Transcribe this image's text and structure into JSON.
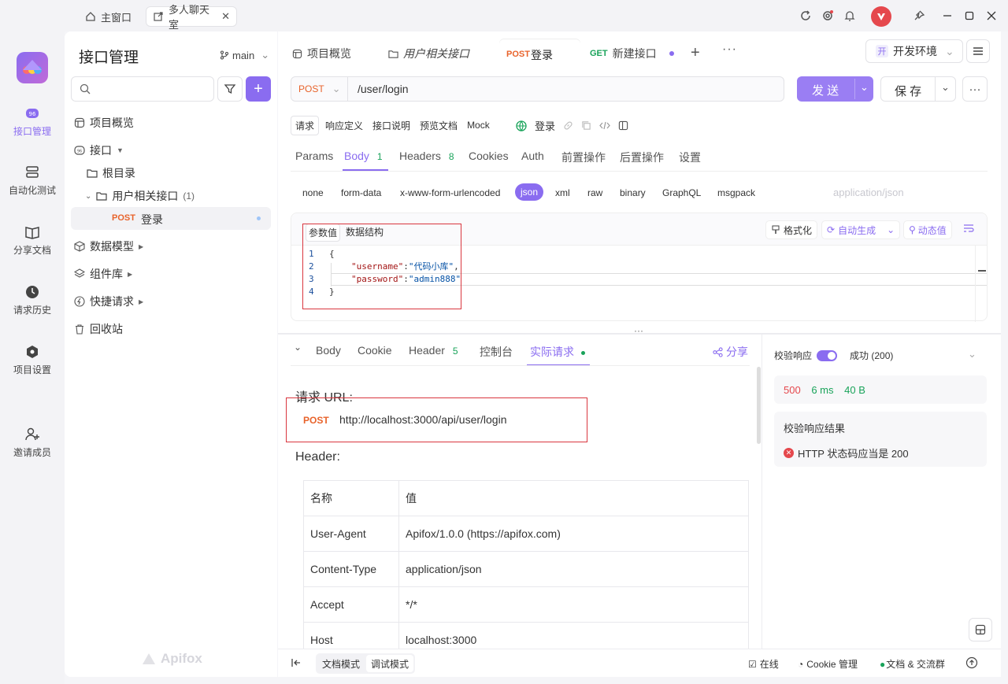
{
  "window": {
    "tabs": [
      {
        "label": "主窗口"
      },
      {
        "label": "多人聊天室"
      }
    ]
  },
  "leftbar": {
    "items": [
      {
        "label": "接口管理"
      },
      {
        "label": "自动化测试"
      },
      {
        "label": "分享文档"
      },
      {
        "label": "请求历史"
      },
      {
        "label": "项目设置"
      },
      {
        "label": "邀请成员"
      }
    ],
    "logo_text": "Apifox"
  },
  "sidepanel": {
    "title": "接口管理",
    "branch": "main",
    "tree": {
      "overview": "项目概览",
      "interfaces": "接口",
      "root": "根目录",
      "folder": "用户相关接口",
      "folder_count": "(1)",
      "endpoint_method": "POST",
      "endpoint_name": "登录",
      "data_models": "数据模型",
      "components": "组件库",
      "quick_request": "快捷请求",
      "recycle": "回收站"
    }
  },
  "main": {
    "tabs": [
      {
        "label": "项目概览"
      },
      {
        "label": "用户相关接口"
      },
      {
        "method": "POST",
        "label": "登录"
      },
      {
        "method": "GET",
        "label": "新建接口"
      }
    ],
    "env": {
      "badge": "开",
      "label": "开发环境"
    },
    "request": {
      "method": "POST",
      "url": "/user/login",
      "send": "发 送",
      "save": "保 存"
    },
    "mode_tabs": [
      "请求",
      "响应定义",
      "接口说明",
      "预览文档",
      "Mock"
    ],
    "endpoint_label": "登录",
    "param_tabs": [
      {
        "label": "Params"
      },
      {
        "label": "Body",
        "count": "1"
      },
      {
        "label": "Headers",
        "count": "8"
      },
      {
        "label": "Cookies"
      },
      {
        "label": "Auth"
      },
      {
        "label": "前置操作"
      },
      {
        "label": "后置操作"
      },
      {
        "label": "设置"
      }
    ],
    "body_types": [
      "none",
      "form-data",
      "x-www-form-urlencoded",
      "json",
      "xml",
      "raw",
      "binary",
      "GraphQL",
      "msgpack"
    ],
    "content_type": "application/json",
    "editor": {
      "tabs": [
        "参数值",
        "数据结构"
      ],
      "tools": {
        "format": "格式化",
        "auto": "自动生成",
        "dynamic": "动态值"
      },
      "lines": [
        {
          "n": "1",
          "text": "{"
        },
        {
          "n": "2",
          "key": "\"username\"",
          "value": "\"代码小库\"",
          "sep": ":",
          "end": ","
        },
        {
          "n": "3",
          "key": "\"password\"",
          "value": "\"admin888\"",
          "sep": ":",
          "end": ""
        },
        {
          "n": "4",
          "text": "}"
        }
      ]
    },
    "response": {
      "tabs": [
        {
          "label": "Body"
        },
        {
          "label": "Cookie"
        },
        {
          "label": "Header",
          "count": "5"
        },
        {
          "label": "控制台"
        },
        {
          "label": "实际请求"
        }
      ],
      "share": "分享",
      "url_heading": "请求 URL:",
      "method": "POST",
      "url": "http://localhost:3000/api/user/login",
      "header_heading": "Header:",
      "table": {
        "head": [
          "名称",
          "值"
        ],
        "rows": [
          [
            "User-Agent",
            "Apifox/1.0.0 (https://apifox.com)"
          ],
          [
            "Content-Type",
            "application/json"
          ],
          [
            "Accept",
            "*/*"
          ],
          [
            "Host",
            "localhost:3000"
          ]
        ]
      }
    },
    "validate": {
      "label": "校验响应",
      "status": "成功 (200)",
      "code": "500",
      "time": "6 ms",
      "size": "40 B",
      "result_title": "校验响应结果",
      "result_msg": "HTTP 状态码应当是 200"
    },
    "footer": {
      "doc_mode": "文档模式",
      "debug_mode": "调试模式",
      "online": "在线",
      "cookie": "Cookie 管理",
      "docs": "文档 & 交流群"
    }
  },
  "colors": {
    "accent": "#8a6cf0",
    "post": "#e8632b",
    "get": "#19a35a",
    "error": "#e5484d",
    "highlight_box": "#d9363e"
  }
}
